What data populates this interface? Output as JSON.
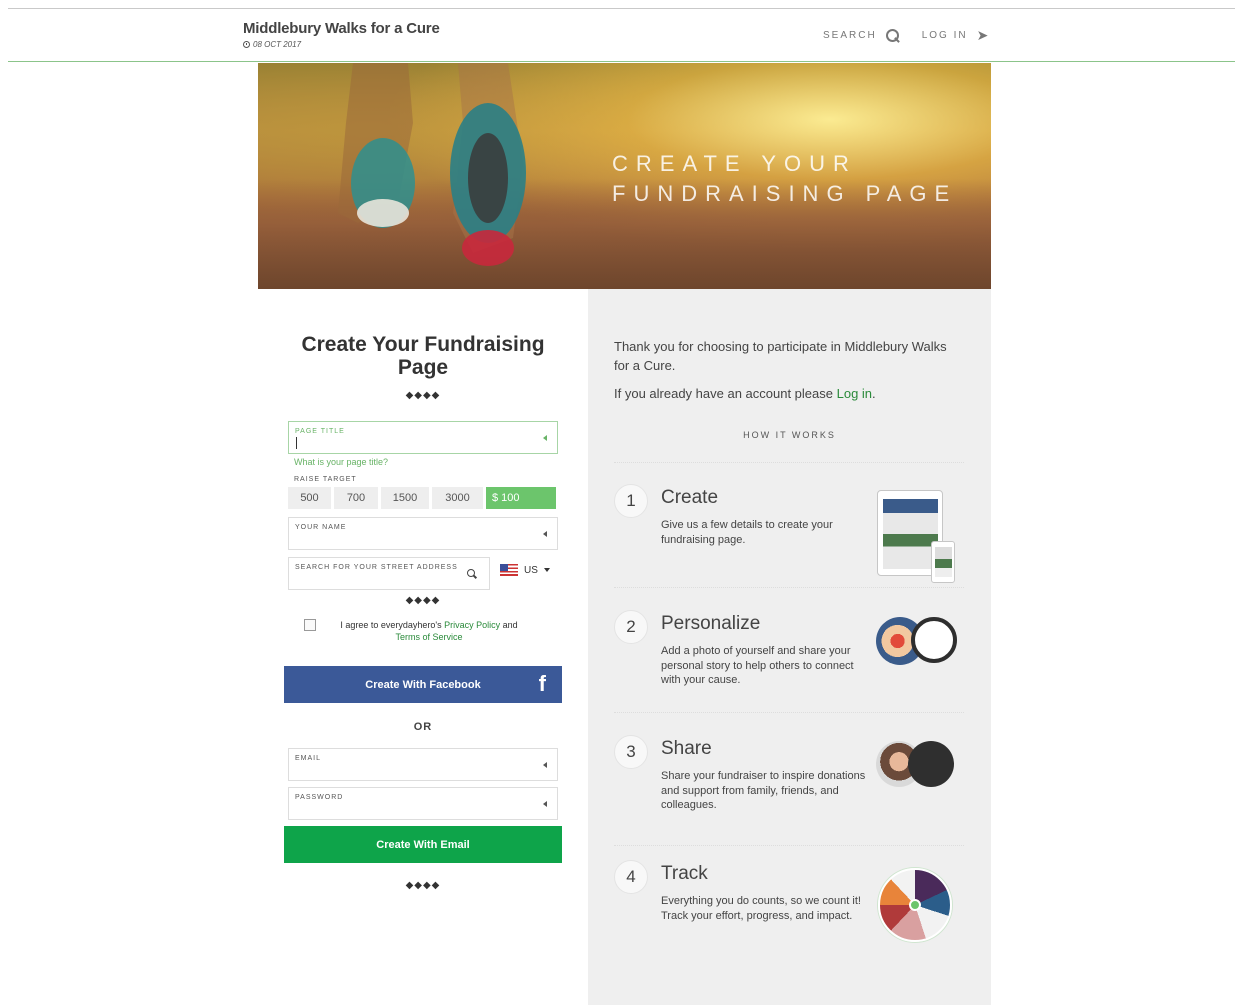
{
  "header": {
    "title": "Middlebury Walks for a Cure",
    "date": "08 OCT 2017",
    "nav": {
      "search": "SEARCH",
      "login": "LOG IN"
    }
  },
  "hero": {
    "line1": "CREATE YOUR",
    "line2": "FUNDRAISING PAGE"
  },
  "form": {
    "heading_line1": "Create Your Fundraising",
    "heading_line2": "Page",
    "divider": "◆◆◆◆",
    "page_title_label": "PAGE TITLE",
    "page_title_hint": "What is your page title?",
    "raise_target_label": "RAISE TARGET",
    "targets": [
      "500",
      "700",
      "1500",
      "3000",
      "$ 100"
    ],
    "your_name_label": "YOUR NAME",
    "address_label": "SEARCH FOR YOUR STREET ADDRESS",
    "country": "US",
    "agree_prefix": "I agree to everydayhero's",
    "privacy_link": "Privacy Policy",
    "agree_and": "and",
    "terms_link": "Terms of Service",
    "facebook_button": "Create With Facebook",
    "facebook_icon": "f",
    "or": "OR",
    "email_label": "EMAIL",
    "password_label": "PASSWORD",
    "email_button": "Create With Email"
  },
  "info": {
    "thanks": "Thank you for choosing to participate in Middlebury Walks for a Cure.",
    "account_prefix": "If you already have an account please",
    "login_link": "Log in",
    "account_suffix": ".",
    "how_it_works": "HOW IT WORKS",
    "steps": [
      {
        "num": "1",
        "title": "Create",
        "desc": "Give us a few details to create your fundraising page."
      },
      {
        "num": "2",
        "title": "Personalize",
        "desc": "Add a photo of yourself and share your personal story to help others to connect with your cause."
      },
      {
        "num": "3",
        "title": "Share",
        "desc": "Share your fundraiser to inspire donations and support from family, friends, and colleagues."
      },
      {
        "num": "4",
        "title": "Track",
        "desc": "Everything you do counts, so we count it! Track your effort, progress, and impact."
      }
    ]
  },
  "colors": {
    "accent_green": "#68b366",
    "facebook_blue": "#3b5998",
    "email_green": "#0ea44a",
    "panel_gray": "#efefef"
  },
  "icons": [
    "clock-icon",
    "search-icon",
    "login-icon",
    "dropdown-arrow-icon",
    "facebook-icon",
    "flag-us-icon",
    "chevron-down-icon"
  ]
}
